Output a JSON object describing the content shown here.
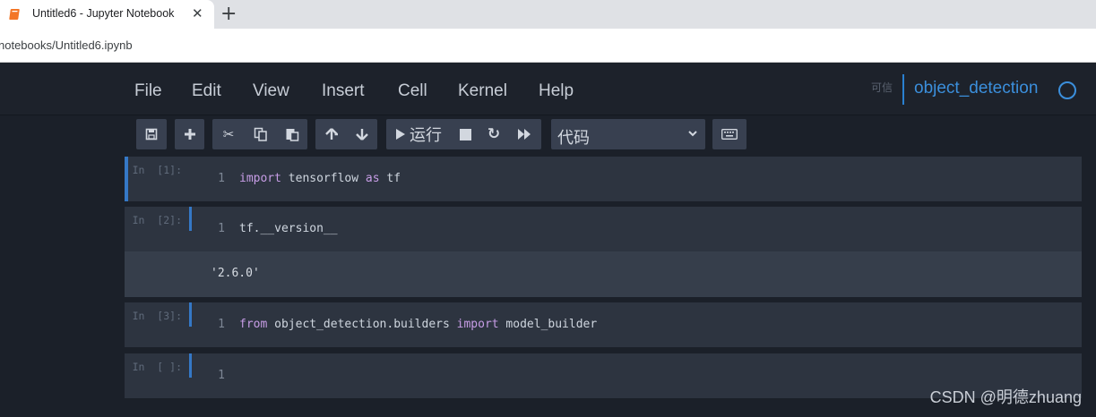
{
  "browser": {
    "tab_title": "Untitled6 - Jupyter Notebook",
    "address": "notebooks/Untitled6.ipynb"
  },
  "menubar": {
    "items": [
      "File",
      "Edit",
      "View",
      "Insert",
      "Cell",
      "Kernel",
      "Help"
    ],
    "trusted_label": "可信",
    "kernel_name": "object_detection"
  },
  "toolbar": {
    "run_label": "运行",
    "cell_type": "代码"
  },
  "cells": [
    {
      "prompt": "In  [1]:",
      "line": "1",
      "code_parts": [
        [
          "import",
          "kw"
        ],
        [
          " tensorflow ",
          ""
        ],
        [
          "as",
          "kw"
        ],
        [
          " tf",
          ""
        ]
      ],
      "output": ""
    },
    {
      "prompt": "In  [2]:",
      "line": "1",
      "code_parts": [
        [
          "tf.__version__",
          ""
        ]
      ],
      "output": "'2.6.0'"
    },
    {
      "prompt": "In  [3]:",
      "line": "1",
      "code_parts": [
        [
          "from",
          "kw"
        ],
        [
          " object_detection.builders ",
          ""
        ],
        [
          "import",
          "kw"
        ],
        [
          " model_builder",
          ""
        ]
      ],
      "output": ""
    },
    {
      "prompt": "In  [ ]:",
      "line": "1",
      "code_parts": [],
      "output": ""
    }
  ],
  "watermark": "CSDN @明德zhuang",
  "colors": {
    "accent": "#3b8fdc",
    "keyword": "#c79de6",
    "cell_bg": "#2d3440",
    "output_bg": "#363e4b",
    "page_bg": "#1b2029"
  },
  "icons": [
    "notebook-favicon",
    "close-icon",
    "plus-icon",
    "save-icon",
    "insert-cell-icon",
    "cut-icon",
    "copy-icon",
    "paste-icon",
    "move-up-icon",
    "move-down-icon",
    "run-icon",
    "stop-icon",
    "restart-icon",
    "fast-forward-icon",
    "chevron-down-icon",
    "keyboard-icon",
    "kernel-idle-icon"
  ]
}
